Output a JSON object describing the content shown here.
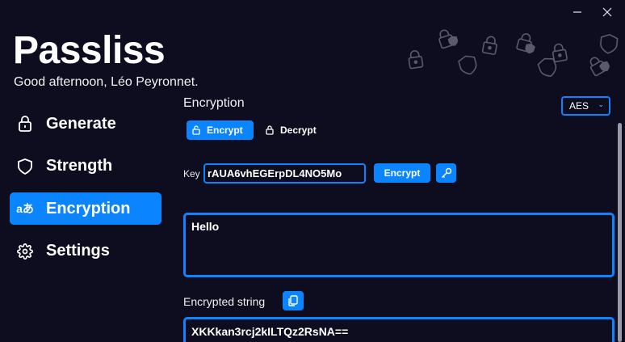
{
  "window": {
    "minimize_icon": "minimize-icon",
    "close_icon": "close-icon"
  },
  "header": {
    "app_title": "Passliss",
    "greeting": "Good afternoon, Léo Peyronnet."
  },
  "sidebar": {
    "items": [
      {
        "label": "Generate",
        "icon": "lock-icon",
        "active": false
      },
      {
        "label": "Strength",
        "icon": "shield-icon",
        "active": false
      },
      {
        "label": "Encryption",
        "icon": "translate-icon",
        "icon_glyph": "aあ",
        "active": true
      },
      {
        "label": "Settings",
        "icon": "gear-icon",
        "active": false
      }
    ]
  },
  "main": {
    "title": "Encryption",
    "algorithm": {
      "selected": "AES"
    },
    "mode_tabs": [
      {
        "label": "Encrypt",
        "icon": "lock-open-icon",
        "active": true
      },
      {
        "label": "Decrypt",
        "icon": "lock-icon",
        "active": false
      }
    ],
    "key": {
      "label": "Key",
      "value": "rAUA6vhEGErpDL4NO5Mo",
      "encrypt_label": "Encrypt",
      "generate_icon": "key-icon"
    },
    "input_text": "Hello",
    "output": {
      "label": "Encrypted string",
      "copy_icon": "copy-icon",
      "value": "XKKkan3rcj2kILTQz2RsNA=="
    }
  },
  "colors": {
    "background": "#0d0d1f",
    "accent": "#0a84ff",
    "text": "#ffffff"
  }
}
